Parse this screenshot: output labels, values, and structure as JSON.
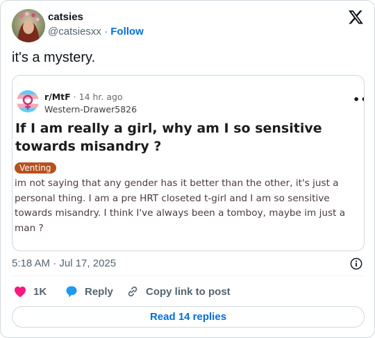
{
  "author": {
    "name": "catsies",
    "handle": "@catsiesxx",
    "separator": "·",
    "follow_label": "Follow"
  },
  "tweet": {
    "text": "it's a mystery.",
    "timestamp": "5:18 AM · Jul 17, 2025"
  },
  "embed": {
    "subreddit": "r/MtF",
    "age": "· 14 hr. ago",
    "username": "Western-Drawer5826",
    "more": "•••",
    "title": "If I am really a girl, why am I so sensitive towards misandry ?",
    "flair": "Venting",
    "flair_color": "#b7501f",
    "body": "im not saying that any gender has it better than the other, it's just a personal thing. I am a pre HRT closeted t-girl and I am so sensitive towards misandry. I think I've always been a tomboy, maybe im just a man ?"
  },
  "actions": {
    "like_count": "1K",
    "reply_label": "Reply",
    "copy_label": "Copy link to post",
    "read_replies_label": "Read 14 replies"
  },
  "colors": {
    "accent": "#006fd6",
    "like": "#f91880",
    "reply": "#1d9bf0",
    "muted": "#536471"
  }
}
